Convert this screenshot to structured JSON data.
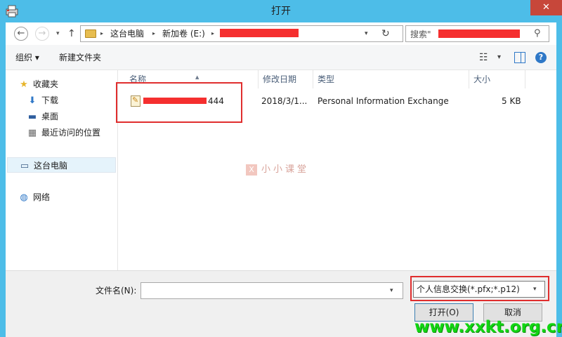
{
  "window": {
    "title": "打开",
    "close_glyph": "✕",
    "app_icon": "printer-icon"
  },
  "nav": {
    "back": "←",
    "forward": "→",
    "recent": "▾",
    "up": "↑"
  },
  "address": {
    "segments": [
      "这台电脑",
      "新加卷 (E:)"
    ],
    "separator": "▸",
    "dropdown": "▾",
    "refresh": "↻"
  },
  "search": {
    "value": "搜索\"",
    "icon": "search-icon"
  },
  "toolbar": {
    "organize": "组织 ▾",
    "new_folder": "新建文件夹",
    "view_icon": "☷",
    "view_dropdown": "▾",
    "help": "?"
  },
  "sidebar": {
    "items": [
      {
        "label": "收藏夹",
        "icon": "★"
      },
      {
        "label": "下载",
        "icon": "⬇"
      },
      {
        "label": "桌面",
        "icon": "▬"
      },
      {
        "label": "最近访问的位置",
        "icon": "▦"
      },
      {
        "label": "这台电脑",
        "icon": "▭"
      },
      {
        "label": "网络",
        "icon": "◍"
      }
    ]
  },
  "filelist": {
    "columns": [
      "名称",
      "修改日期",
      "类型",
      "大小"
    ],
    "sort_arrow": "▲",
    "rows": [
      {
        "name_suffix": "444",
        "modified": "2018/3/1...",
        "type": "Personal Information Exchange",
        "size": "5 KB"
      }
    ]
  },
  "watermark": {
    "logo": "X",
    "text": "小小课堂"
  },
  "bottom": {
    "filename_label": "文件名(N):",
    "filename_value": "",
    "filename_dropdown": "▾",
    "filter": "个人信息交换(*.pfx;*.p12)",
    "filter_dropdown": "▾",
    "open_label": "打开(O)",
    "cancel_label": "取消",
    "site_watermark": "www.xxkt.org.cn"
  },
  "colors": {
    "frame": "#4dbde8",
    "close": "#c7473a",
    "redaction": "#f52f2f",
    "highlight": "#e02e2e",
    "site_watermark": "#12d612"
  }
}
